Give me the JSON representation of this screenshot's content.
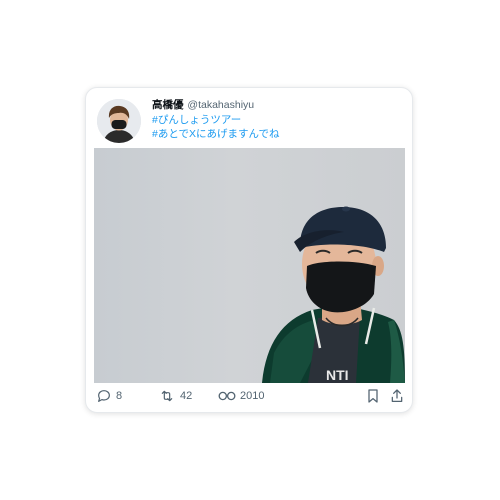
{
  "tweet": {
    "display_name": "高橋優",
    "handle": "@takahashiyu",
    "lines": [
      "#ぴんしょうツアー",
      "#あとでXにあげますんでね"
    ]
  },
  "actions": {
    "replies": "8",
    "retweets": "42",
    "views": "2010"
  },
  "icons": {
    "reply": "reply-icon",
    "retweet": "retweet-icon",
    "views": "views-icon",
    "bookmark": "bookmark-icon",
    "share": "share-icon"
  },
  "colors": {
    "link": "#1d9bf0",
    "text": "#0f1419",
    "muted": "#536471"
  }
}
